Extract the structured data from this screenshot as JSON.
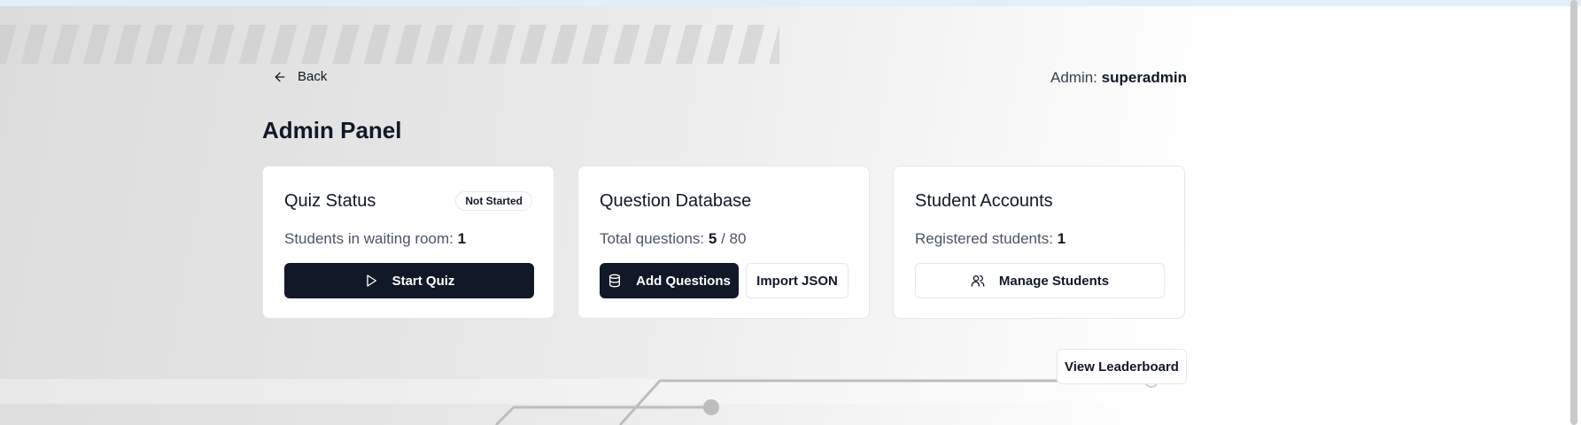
{
  "header": {
    "back_label": "Back",
    "admin_prefix": "Admin:",
    "admin_user": "superadmin"
  },
  "page": {
    "title": "Admin Panel"
  },
  "cards": {
    "quiz_status": {
      "title": "Quiz Status",
      "badge": "Not Started",
      "text_label": "Students in waiting room:",
      "text_value": "1",
      "button_label": "Start Quiz"
    },
    "question_db": {
      "title": "Question Database",
      "text_label": "Total questions:",
      "text_value": "5",
      "text_total": "/ 80",
      "add_button_label": "Add Questions",
      "import_button_label": "Import JSON"
    },
    "students": {
      "title": "Student Accounts",
      "text_label": "Registered students:",
      "text_value": "1",
      "button_label": "Manage Students"
    }
  },
  "footer": {
    "leaderboard_label": "View Leaderboard"
  },
  "icons": {
    "back": "arrow-left-icon",
    "start": "play-icon",
    "add": "database-icon",
    "manage": "users-icon"
  },
  "colors": {
    "primary_dark": "#111827",
    "border": "#e5e7eb"
  }
}
